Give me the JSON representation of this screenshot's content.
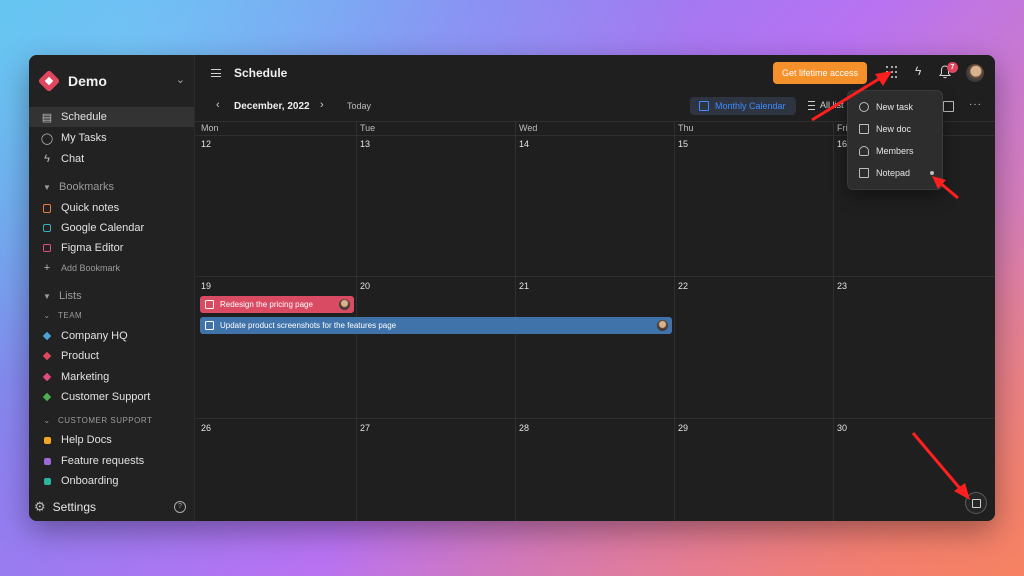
{
  "workspace": {
    "name": "Demo"
  },
  "nav": [
    {
      "label": "Schedule",
      "icon": "calendar-icon",
      "active": true
    },
    {
      "label": "My Tasks",
      "icon": "check-circle-icon"
    },
    {
      "label": "Chat",
      "icon": "bolt-icon"
    }
  ],
  "bookmarks": {
    "title": "Bookmarks",
    "items": [
      {
        "label": "Quick notes",
        "color": "#e87a3e"
      },
      {
        "label": "Google Calendar",
        "color": "#3aaeb8"
      },
      {
        "label": "Figma Editor",
        "color": "#e24a80"
      }
    ],
    "add_label": "Add Bookmark"
  },
  "lists": {
    "title": "Lists",
    "team_label": "TEAM",
    "team_items": [
      {
        "label": "Company HQ",
        "color": "#4aa3d8"
      },
      {
        "label": "Product",
        "color": "#e0475f"
      },
      {
        "label": "Marketing",
        "color": "#e24a80"
      },
      {
        "label": "Customer Support",
        "color": "#4caf50"
      }
    ],
    "support_label": "CUSTOMER SUPPORT",
    "support_items": [
      {
        "label": "Help Docs",
        "color": "#f5a623"
      },
      {
        "label": "Feature requests",
        "color": "#9c6ad8"
      },
      {
        "label": "Onboarding",
        "color": "#2bb4a0"
      }
    ]
  },
  "settings_label": "Settings",
  "header": {
    "title": "Schedule",
    "cta_label": "Get lifetime access",
    "notifications_count": "7"
  },
  "calendar": {
    "month_label": "December, 2022",
    "today_label": "Today",
    "view_label": "Monthly Calendar",
    "list_label": "All list",
    "weekdays": [
      "Mon",
      "Tue",
      "Wed",
      "Thu",
      "Fri"
    ],
    "weeks": [
      [
        "12",
        "13",
        "14",
        "15",
        "16"
      ],
      [
        "19",
        "20",
        "21",
        "22",
        "23"
      ],
      [
        "26",
        "27",
        "28",
        "29",
        "30"
      ]
    ],
    "tasks": [
      {
        "title": "Redesign the pricing page",
        "color": "#d94b63"
      },
      {
        "title": "Update product screenshots for the features page",
        "color": "#3f73aa"
      }
    ]
  },
  "menu": {
    "items": [
      {
        "label": "New task",
        "icon": "check-circle-icon"
      },
      {
        "label": "New doc",
        "icon": "doc-icon"
      },
      {
        "label": "Members",
        "icon": "members-icon"
      },
      {
        "label": "Notepad",
        "icon": "notepad-icon"
      }
    ]
  }
}
